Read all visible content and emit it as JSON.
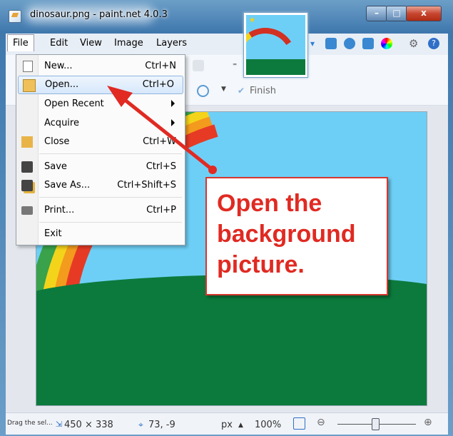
{
  "window": {
    "title": "dinosaur.png - paint.net 4.0.3",
    "minimize": "–",
    "maximize": "□",
    "close": "x"
  },
  "menubar": {
    "items": [
      "File",
      "Edit",
      "View",
      "Image",
      "Layers"
    ]
  },
  "toolbar": {
    "finish_label": "Finish"
  },
  "file_menu": {
    "items": [
      {
        "label": "New...",
        "shortcut": "Ctrl+N"
      },
      {
        "label": "Open...",
        "shortcut": "Ctrl+O"
      },
      {
        "label": "Open Recent",
        "shortcut": ""
      },
      {
        "label": "Acquire",
        "shortcut": ""
      },
      {
        "label": "Close",
        "shortcut": "Ctrl+W"
      },
      {
        "label": "Save",
        "shortcut": "Ctrl+S"
      },
      {
        "label": "Save As...",
        "shortcut": "Ctrl+Shift+S"
      },
      {
        "label": "Print...",
        "shortcut": "Ctrl+P"
      },
      {
        "label": "Exit",
        "shortcut": ""
      }
    ]
  },
  "callout": {
    "text": "Open the background picture."
  },
  "statusbar": {
    "hint": "Drag the sel...",
    "image_size": "450 × 338",
    "cursor_pos": "73, -9",
    "unit": "px",
    "zoom": "100%"
  },
  "colors": {
    "sky": "#6ecff6",
    "grass": "#0c7a3c",
    "callout_red": "#e02a22",
    "highlight": "#d7e8fb"
  }
}
